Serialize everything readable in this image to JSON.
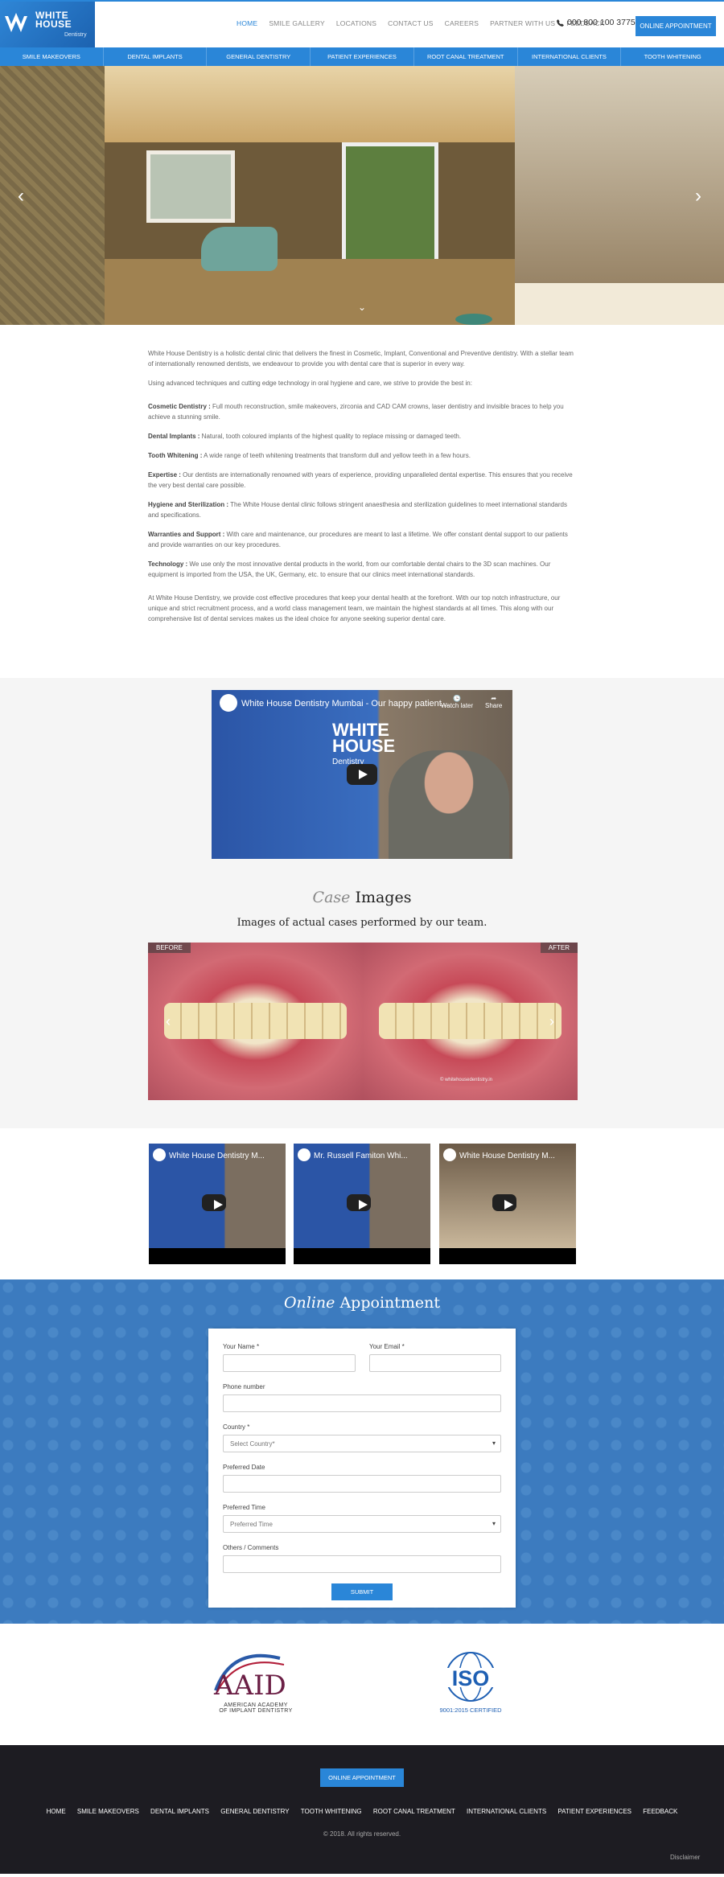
{
  "header": {
    "logo_text_line1": "WHITE",
    "logo_text_line2": "HOUSE",
    "logo_text_line3": "Dentistry",
    "nav": [
      "HOME",
      "SMILE GALLERY",
      "LOCATIONS",
      "CONTACT US",
      "CAREERS",
      "PARTNER WITH US",
      "FEEDBACK"
    ],
    "phone": "000 800 100 3775",
    "appointment_button": "ONLINE APPOINTMENT"
  },
  "menu": [
    "SMILE MAKEOVERS",
    "DENTAL IMPLANTS",
    "GENERAL DENTISTRY",
    "PATIENT EXPERIENCES",
    "ROOT CANAL TREATMENT",
    "INTERNATIONAL CLIENTS",
    "TOOTH WHITENING"
  ],
  "intro": {
    "p1": "White House Dentistry is a holistic dental clinic that delivers the finest in Cosmetic, Implant, Conventional and Preventive dentistry. With a stellar team of internationally renowned dentists, we endeavour to provide you with dental care that is superior in every way.",
    "p2": "Using advanced techniques and cutting edge technology in oral hygiene and care, we strive to provide the best in:",
    "items": [
      {
        "term": "Cosmetic Dentistry :",
        "text": " Full mouth reconstruction, smile makeovers, zirconia and CAD CAM crowns, laser dentistry and invisible braces to help you achieve a stunning smile."
      },
      {
        "term": "Dental Implants :",
        "text": " Natural, tooth coloured implants of the highest quality to replace missing or damaged teeth."
      },
      {
        "term": "Tooth Whitening :",
        "text": " A wide range of teeth whitening treatments that transform dull and yellow teeth in a few hours."
      },
      {
        "term": "Expertise :",
        "text": " Our dentists are internationally renowned with years of experience, providing unparalleled dental expertise. This ensures that you receive the very best dental care possible."
      },
      {
        "term": "Hygiene and Sterilization :",
        "text": " The White House dental clinic follows stringent anaesthesia and sterilization guidelines to meet international standards and specifications."
      },
      {
        "term": "Warranties and Support :",
        "text": " With care and maintenance, our procedures are meant to last a lifetime. We offer constant dental support to our patients and provide warranties on our key procedures."
      },
      {
        "term": "Technology :",
        "text": " We use only the most innovative dental products in the world, from our comfortable dental chairs to the 3D scan machines. Our equipment is imported from the USA, the UK, Germany, etc. to ensure that our clinics meet international standards."
      }
    ],
    "p3": "At White House Dentistry, we provide cost effective procedures that keep your dental health at the forefront. With our top notch infrastructure, our unique and strict recruitment process, and a world class management team, we maintain the highest standards at all times. This along with our comprehensive list of dental services makes us the ideal choice for anyone seeking superior dental care."
  },
  "main_video": {
    "title": "White House Dentistry Mumbai - Our happy patient...",
    "watch_later": "Watch later",
    "share": "Share",
    "brand_line1": "WHITE",
    "brand_line2": "HOUSE",
    "brand_line3": "Dentistry"
  },
  "case": {
    "title_italic": "Case",
    "title_rest": " Images",
    "subtitle": "Images of actual cases performed by our team.",
    "before": "BEFORE",
    "after": "AFTER",
    "watermark": "© whitehousedentistry.in"
  },
  "videos": [
    {
      "title": "White House Dentistry M..."
    },
    {
      "title": "Mr. Russell Famiton Whi..."
    },
    {
      "title": "White House Dentistry M..."
    }
  ],
  "appointment": {
    "title_italic": "Online",
    "title_rest": " Appointment",
    "name_label": "Your Name *",
    "email_label": "Your Email *",
    "phone_label": "Phone number",
    "country_label": "Country *",
    "country_placeholder": "Select Country*",
    "date_label": "Preferred Date",
    "time_label": "Preferred Time",
    "time_placeholder": "Preferred Time",
    "comments_label": "Others / Comments",
    "submit": "SUBMIT"
  },
  "logos": {
    "aaid_line1": "AMERICAN ACADEMY",
    "aaid_line2": "OF IMPLANT DENTISTRY",
    "iso_text": "ISO",
    "iso_cert": "9001:2015 CERTIFIED"
  },
  "footer": {
    "button": "ONLINE APPOINTMENT",
    "nav": [
      "HOME",
      "SMILE MAKEOVERS",
      "DENTAL IMPLANTS",
      "GENERAL DENTISTRY",
      "TOOTH WHITENING",
      "ROOT CANAL TREATMENT",
      "INTERNATIONAL CLIENTS",
      "PATIENT EXPERIENCES",
      "FEEDBACK"
    ],
    "copyright": "© 2018. All rights reserved.",
    "disclaimer": "Disclaimer"
  },
  "colors": {
    "brand_blue": "#2a86d8",
    "footer_bg": "#1d1c22",
    "appointment_bg": "#3c7bbf"
  }
}
